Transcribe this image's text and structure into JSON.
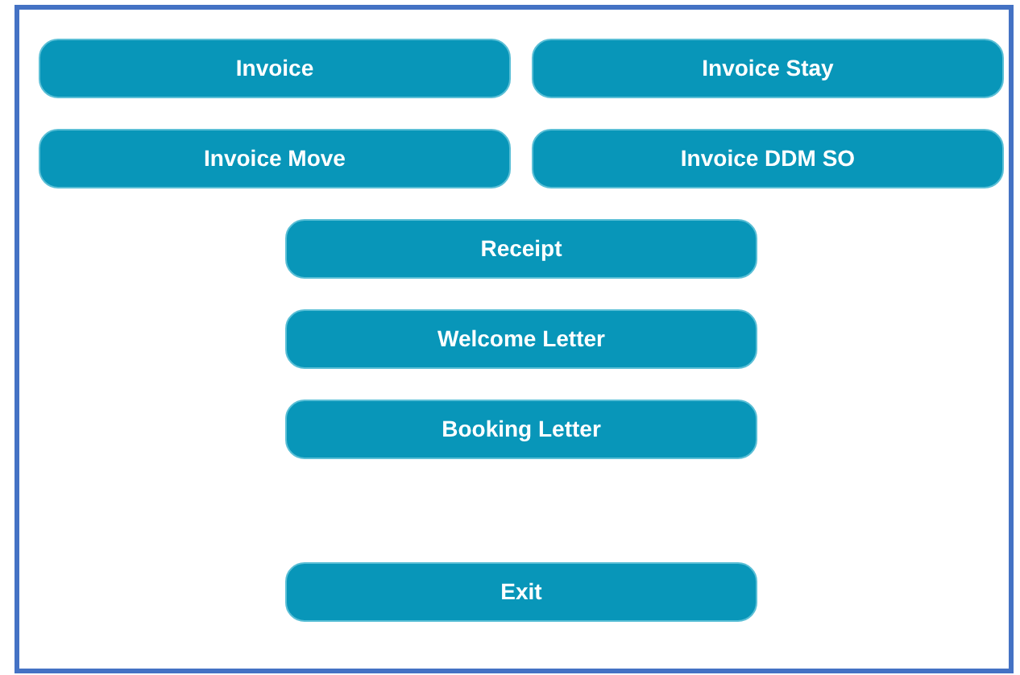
{
  "invoice_buttons": [
    "Invoice",
    "Invoice Stay",
    "Invoice Move",
    "Invoice DDM SO"
  ],
  "letter_buttons": [
    "Receipt",
    "Welcome Letter",
    "Booking Letter"
  ],
  "exit_button": "Exit"
}
